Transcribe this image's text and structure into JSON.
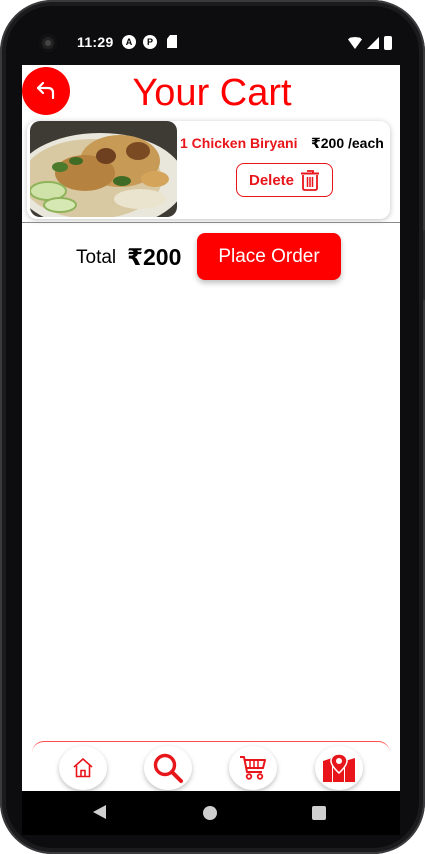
{
  "status_bar": {
    "time": "11:29"
  },
  "header": {
    "title": "Your Cart"
  },
  "cart": {
    "items": [
      {
        "name": "1 Chicken Biryani",
        "price": "₹200 /each",
        "delete_label": "Delete"
      }
    ]
  },
  "summary": {
    "total_label": "Total",
    "total_value": "₹200",
    "place_order_label": "Place Order"
  },
  "bottom_nav": {
    "icons": [
      "home-icon",
      "search-icon",
      "cart-icon",
      "map-icon"
    ]
  },
  "colors": {
    "accent": "#ff0000",
    "accent_text": "#e8151b"
  }
}
